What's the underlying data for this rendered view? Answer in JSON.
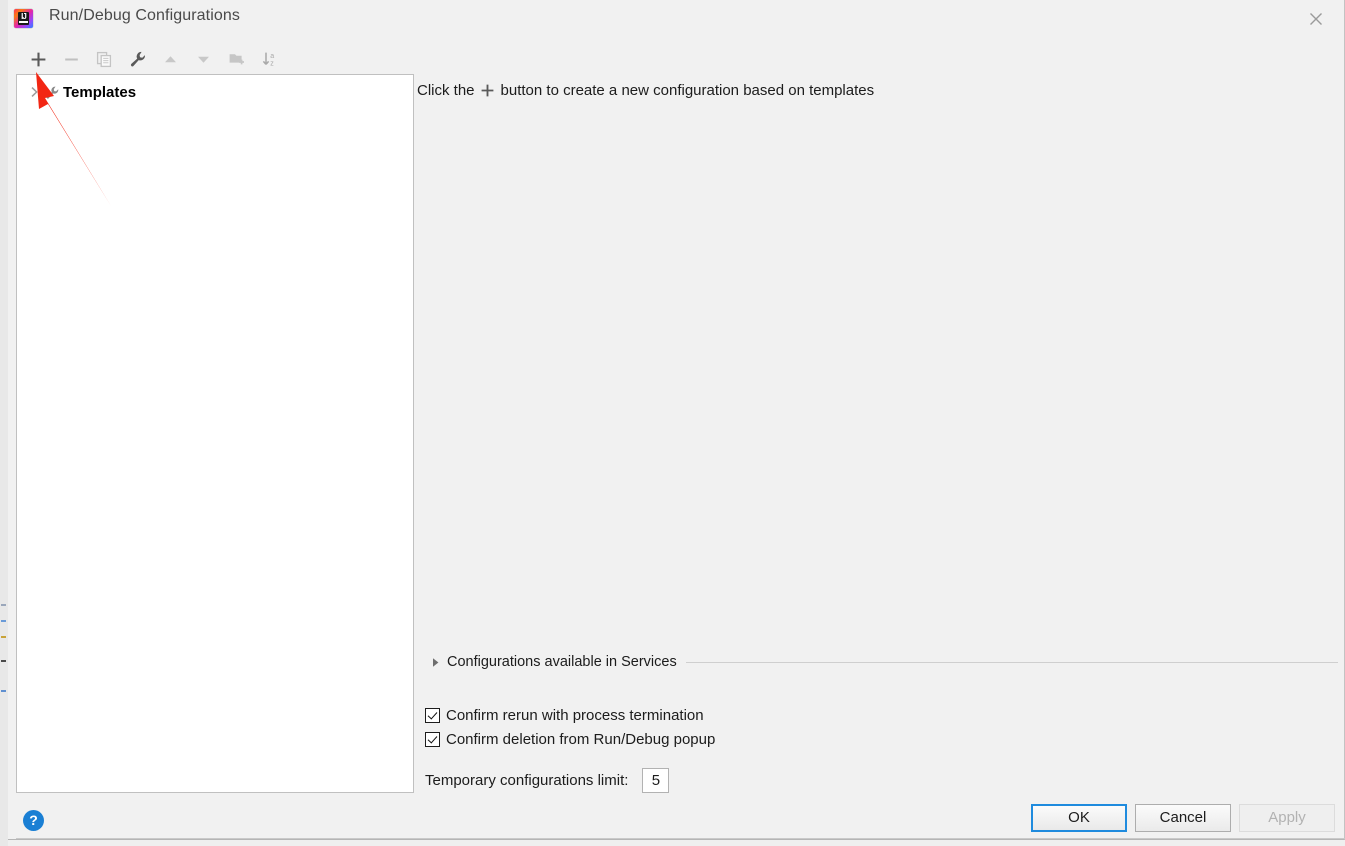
{
  "window": {
    "title": "Run/Debug Configurations",
    "app_icon": "intellij-idea-icon",
    "icon_letters": "IJ",
    "close_icon": "close-icon"
  },
  "toolbar": {
    "buttons": [
      {
        "name": "add-configuration-button",
        "icon": "plus-icon",
        "label": "Add New Configuration",
        "enabled": true
      },
      {
        "name": "remove-configuration-button",
        "icon": "minus-icon",
        "label": "Remove Configuration",
        "enabled": false
      },
      {
        "name": "copy-configuration-button",
        "icon": "copy-icon",
        "label": "Copy Configuration",
        "enabled": false
      },
      {
        "name": "edit-templates-button",
        "icon": "wrench-icon",
        "label": "Edit Templates",
        "enabled": true
      },
      {
        "name": "move-up-button",
        "icon": "arrow-up-icon",
        "label": "Move Up",
        "enabled": false
      },
      {
        "name": "move-down-button",
        "icon": "arrow-down-icon",
        "label": "Move Down",
        "enabled": false
      },
      {
        "name": "new-folder-button",
        "icon": "folder-add-icon",
        "label": "Create New Folder",
        "enabled": false
      },
      {
        "name": "sort-button",
        "icon": "sort-az-icon",
        "label": "Sort Configurations",
        "enabled": true
      }
    ]
  },
  "tree": {
    "nodes": [
      {
        "label": "Templates",
        "icon": "wrench-icon",
        "chevron": "chevron-right-icon",
        "expanded": false,
        "bold": true
      }
    ]
  },
  "main": {
    "hint_before": "Click the",
    "hint_icon": "plus-icon",
    "hint_after": "button to create a new configuration based on templates"
  },
  "services_section": {
    "label": "Configurations available in Services",
    "triangle_icon": "triangle-right-icon",
    "expanded": false
  },
  "options": {
    "confirm_rerun": {
      "label": "Confirm rerun with process termination",
      "checked": true
    },
    "confirm_deletion": {
      "label": "Confirm deletion from Run/Debug popup",
      "checked": true
    },
    "temp_limit": {
      "label": "Temporary configurations limit:",
      "value": "5"
    }
  },
  "footer": {
    "help_label": "?",
    "help_icon": "help-icon",
    "ok_label": "OK",
    "cancel_label": "Cancel",
    "apply_label": "Apply",
    "apply_enabled": false
  },
  "annotation": {
    "type": "red-arrow",
    "points_to": "add-configuration-button",
    "color": "#f22613"
  },
  "colors": {
    "dialog_background": "#f1f1f1",
    "panel_background": "#ffffff",
    "accent_blue": "#1f8bde",
    "help_blue": "#1a7fd4",
    "annotation_red": "#f22613",
    "text": "#1c1c1c",
    "title_text": "#4a4a4a",
    "disabled_text": "#b2b2b2"
  }
}
